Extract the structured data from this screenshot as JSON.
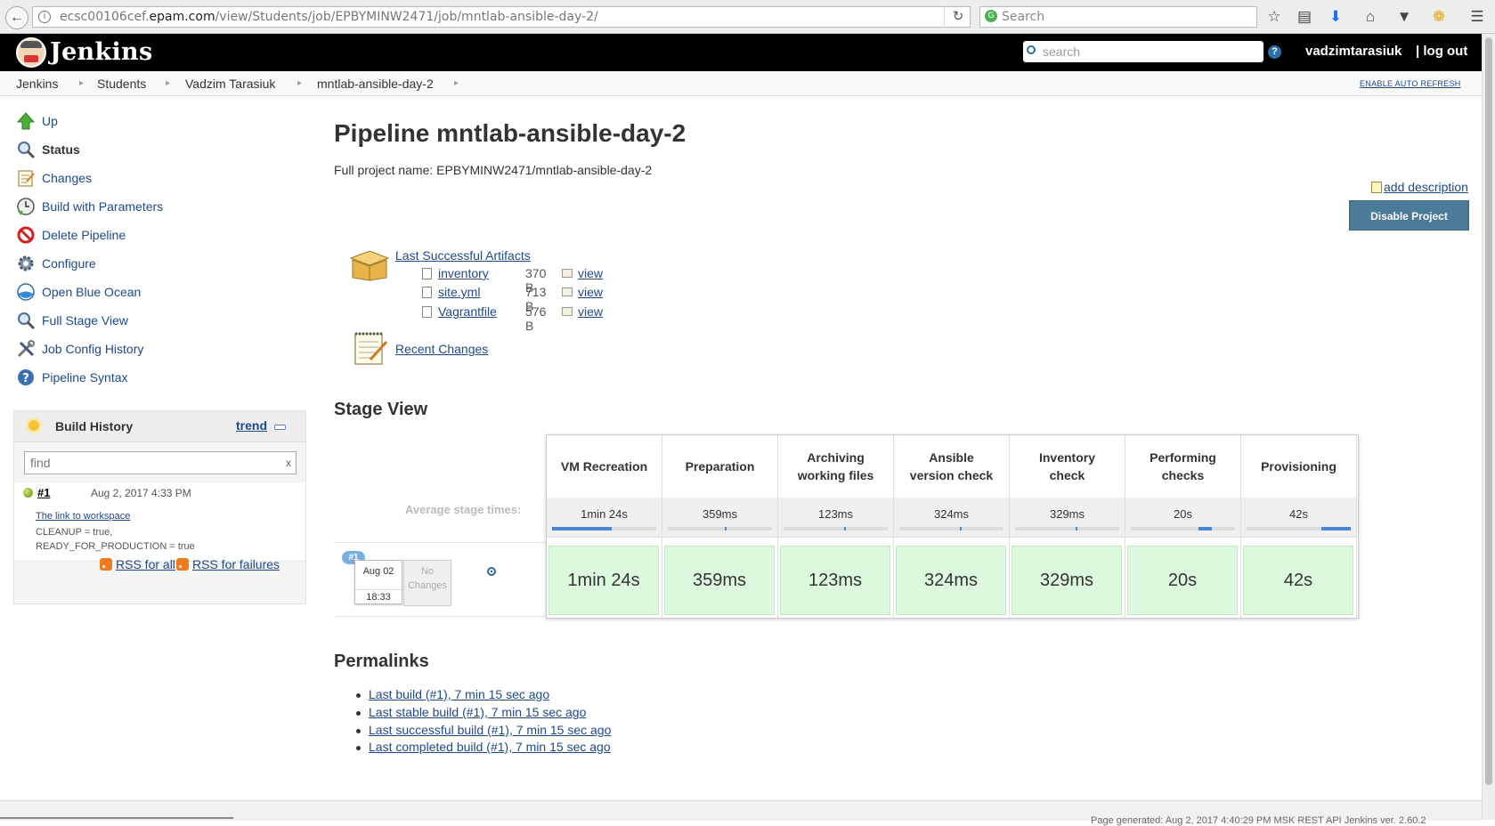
{
  "browser": {
    "url_prefix": "ecsc00106cef.",
    "url_domain": "epam.com",
    "url_path": "/view/Students/job/EPBYMINW2471/job/mntlab-ansible-day-2/",
    "search_placeholder": "Search",
    "back_icon": "back-arrow-icon",
    "reload_icon": "reload-icon"
  },
  "header": {
    "brand": "Jenkins",
    "search_placeholder": "search",
    "help": "?",
    "user": "vadzimtarasiuk",
    "logout": "| log out"
  },
  "breadcrumb": {
    "items": [
      "Jenkins",
      "Students",
      "Vadzim Tarasiuk",
      "mntlab-ansible-day-2"
    ],
    "auto_refresh": "ENABLE AUTO REFRESH"
  },
  "sidebar": {
    "tasks": [
      {
        "label": "Up",
        "icon": "up-arrow-icon"
      },
      {
        "label": "Status",
        "icon": "magnifier-icon"
      },
      {
        "label": "Changes",
        "icon": "notepad-icon"
      },
      {
        "label": "Build with Parameters",
        "icon": "build-clock-icon"
      },
      {
        "label": "Delete Pipeline",
        "icon": "delete-icon"
      },
      {
        "label": "Configure",
        "icon": "gear-icon"
      },
      {
        "label": "Open Blue Ocean",
        "icon": "blue-ocean-icon"
      },
      {
        "label": "Full Stage View",
        "icon": "magnifier-icon"
      },
      {
        "label": "Job Config History",
        "icon": "tools-icon"
      },
      {
        "label": "Pipeline Syntax",
        "icon": "help-icon"
      }
    ]
  },
  "build_history": {
    "title": "Build History",
    "trend": "trend",
    "find_placeholder": "find",
    "find_clear": "x",
    "builds": [
      {
        "number": "#1",
        "date": "Aug 2, 2017 4:33 PM",
        "workspace_link": "The link to workspace",
        "params_line1": "CLEANUP = true,",
        "params_line2": "READY_FOR_PRODUCTION = true",
        "status_color": "#6e9a1e"
      }
    ],
    "rss_all": "RSS for all",
    "rss_failures": "RSS for failures"
  },
  "main": {
    "title": "Pipeline mntlab-ansible-day-2",
    "full_name": "Full project name: EPBYMINW2471/mntlab-ansible-day-2",
    "add_description": "add description",
    "disable_button": "Disable Project",
    "artifacts": {
      "title": "Last Successful Artifacts",
      "files": [
        {
          "name": "inventory",
          "size": "370 B",
          "view": "view"
        },
        {
          "name": "site.yml",
          "size": "713 B",
          "view": "view"
        },
        {
          "name": "Vagrantfile",
          "size": "576 B",
          "view": "view"
        }
      ]
    },
    "recent_changes": "Recent Changes"
  },
  "stage_view": {
    "title": "Stage View",
    "avg_label": "Average stage times:",
    "stages": [
      {
        "name_line1": "VM Recreation",
        "name_line2": "",
        "avg": "1min 24s",
        "bar_start": 0.0,
        "bar_fraction": 0.57,
        "run_time": "1min 24s"
      },
      {
        "name_line1": "Preparation",
        "name_line2": "",
        "avg": "359ms",
        "bar_start": 0.55,
        "bar_fraction": 0.02,
        "run_time": "359ms"
      },
      {
        "name_line1": "Archiving",
        "name_line2": "working files",
        "avg": "123ms",
        "bar_start": 0.58,
        "bar_fraction": 0.01,
        "run_time": "123ms"
      },
      {
        "name_line1": "Ansible",
        "name_line2": "version check",
        "avg": "324ms",
        "bar_start": 0.58,
        "bar_fraction": 0.01,
        "run_time": "324ms"
      },
      {
        "name_line1": "Inventory",
        "name_line2": "check",
        "avg": "329ms",
        "bar_start": 0.58,
        "bar_fraction": 0.02,
        "run_time": "329ms"
      },
      {
        "name_line1": "Performing",
        "name_line2": "checks",
        "avg": "20s",
        "bar_start": 0.65,
        "bar_fraction": 0.13,
        "run_time": "20s"
      },
      {
        "name_line1": "Provisioning",
        "name_line2": "",
        "avg": "42s",
        "bar_start": 0.72,
        "bar_fraction": 0.28,
        "run_time": "42s"
      }
    ],
    "run": {
      "badge": "#1",
      "date": "Aug 02",
      "time": "18:33",
      "changes_line1": "No",
      "changes_line2": "Changes",
      "success_color": "#ddf9dd"
    }
  },
  "permalinks": {
    "title": "Permalinks",
    "items": [
      "Last build (#1), 7 min 15 sec ago",
      "Last stable build (#1), 7 min 15 sec ago",
      "Last successful build (#1), 7 min 15 sec ago",
      "Last completed build (#1), 7 min 15 sec ago"
    ]
  },
  "footer": {
    "text": "Page generated: Aug 2, 2017 4:40:29 PM MSK    REST API    Jenkins ver. 2.60.2"
  }
}
